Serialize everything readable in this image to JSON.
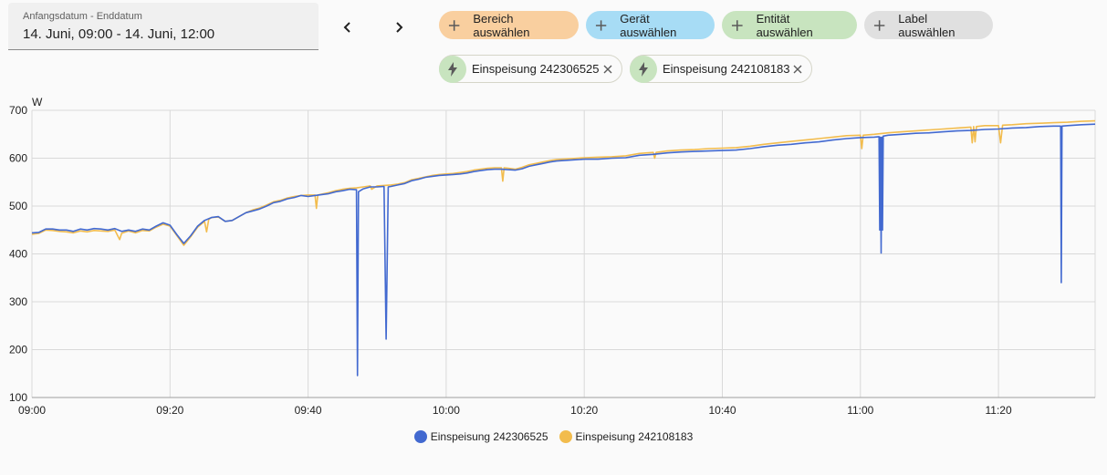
{
  "date_range": {
    "label": "Anfangsdatum - Enddatum",
    "value": "14. Juni, 09:00 - 14. Juni, 12:00"
  },
  "nav": {
    "prev_icon": "chevron-left-icon",
    "next_icon": "chevron-right-icon"
  },
  "target_chips": {
    "area": "Bereich auswählen",
    "device": "Gerät auswählen",
    "entity": "Entität auswählen",
    "label": "Label auswählen"
  },
  "selected_entities": [
    {
      "name": "Einspeisung 242306525",
      "icon": "lightning-bolt-icon"
    },
    {
      "name": "Einspeisung 242108183",
      "icon": "lightning-bolt-icon"
    }
  ],
  "colors": {
    "chip_area": "#f9cf9f",
    "chip_device": "#a7dcf5",
    "chip_entity": "#c8e4bf",
    "chip_label": "#e0e0e0",
    "series1": "#4269d0",
    "series2": "#f2bc4d"
  },
  "chart_data": {
    "type": "line",
    "ylabel": "W",
    "ylim": [
      100,
      700
    ],
    "yticks": [
      100,
      200,
      300,
      400,
      500,
      600,
      700
    ],
    "xlim_minutes": [
      0,
      154
    ],
    "xticks": [
      {
        "label": "09:00",
        "t": 0
      },
      {
        "label": "09:20",
        "t": 20
      },
      {
        "label": "09:40",
        "t": 40
      },
      {
        "label": "10:00",
        "t": 60
      },
      {
        "label": "10:20",
        "t": 80
      },
      {
        "label": "10:40",
        "t": 100
      },
      {
        "label": "11:00",
        "t": 120
      },
      {
        "label": "11:20",
        "t": 140
      }
    ],
    "grid": true,
    "legend_position": "bottom",
    "series": [
      {
        "name": "Einspeisung 242306525",
        "color": "#4269d0",
        "points": [
          [
            0,
            444
          ],
          [
            1,
            445
          ],
          [
            2,
            452
          ],
          [
            3,
            452
          ],
          [
            4,
            450
          ],
          [
            5,
            450
          ],
          [
            6,
            447
          ],
          [
            7,
            452
          ],
          [
            8,
            450
          ],
          [
            9,
            453
          ],
          [
            10,
            452
          ],
          [
            11,
            450
          ],
          [
            12,
            453
          ],
          [
            13,
            447
          ],
          [
            14,
            450
          ],
          [
            15,
            447
          ],
          [
            16,
            452
          ],
          [
            17,
            450
          ],
          [
            18,
            458
          ],
          [
            19,
            465
          ],
          [
            20,
            460
          ],
          [
            21,
            440
          ],
          [
            22,
            422
          ],
          [
            23,
            438
          ],
          [
            24,
            458
          ],
          [
            25,
            470
          ],
          [
            26,
            476
          ],
          [
            27,
            478
          ],
          [
            28,
            468
          ],
          [
            29,
            470
          ],
          [
            30,
            478
          ],
          [
            31,
            486
          ],
          [
            32,
            490
          ],
          [
            33,
            494
          ],
          [
            34,
            500
          ],
          [
            35,
            507
          ],
          [
            36,
            510
          ],
          [
            37,
            515
          ],
          [
            38,
            518
          ],
          [
            39,
            522
          ],
          [
            40,
            520
          ],
          [
            41,
            522
          ],
          [
            42,
            524
          ],
          [
            43,
            526
          ],
          [
            44,
            530
          ],
          [
            45,
            532
          ],
          [
            46,
            535
          ],
          [
            47,
            534
          ],
          [
            47.15,
            146
          ],
          [
            47.3,
            530
          ],
          [
            48,
            536
          ],
          [
            49,
            540
          ],
          [
            50,
            540
          ],
          [
            51,
            541
          ],
          [
            51.3,
            222
          ],
          [
            51.6,
            540
          ],
          [
            52,
            541
          ],
          [
            53,
            544
          ],
          [
            54,
            547
          ],
          [
            55,
            553
          ],
          [
            56,
            556
          ],
          [
            57,
            560
          ],
          [
            58,
            562
          ],
          [
            59,
            564
          ],
          [
            60,
            565
          ],
          [
            61,
            566
          ],
          [
            62,
            567
          ],
          [
            63,
            569
          ],
          [
            64,
            572
          ],
          [
            65,
            574
          ],
          [
            66,
            576
          ],
          [
            67,
            577
          ],
          [
            68,
            577
          ],
          [
            69,
            576
          ],
          [
            70,
            575
          ],
          [
            71,
            578
          ],
          [
            72,
            583
          ],
          [
            73,
            586
          ],
          [
            74,
            589
          ],
          [
            75,
            592
          ],
          [
            76,
            594
          ],
          [
            77,
            595
          ],
          [
            78,
            596
          ],
          [
            79,
            597
          ],
          [
            80,
            598
          ],
          [
            82,
            598
          ],
          [
            84,
            600
          ],
          [
            86,
            601
          ],
          [
            88,
            606
          ],
          [
            90,
            608
          ],
          [
            92,
            611
          ],
          [
            94,
            613
          ],
          [
            96,
            614
          ],
          [
            98,
            615
          ],
          [
            100,
            616
          ],
          [
            102,
            617
          ],
          [
            104,
            620
          ],
          [
            106,
            624
          ],
          [
            108,
            627
          ],
          [
            110,
            629
          ],
          [
            112,
            632
          ],
          [
            114,
            634
          ],
          [
            116,
            638
          ],
          [
            118,
            641
          ],
          [
            120,
            643
          ],
          [
            122,
            644
          ],
          [
            122.7,
            645
          ],
          [
            122.8,
            450
          ],
          [
            122.9,
            644
          ],
          [
            123,
            402
          ],
          [
            123.1,
            644
          ],
          [
            123.2,
            450
          ],
          [
            123.3,
            646
          ],
          [
            124,
            648
          ],
          [
            126,
            650
          ],
          [
            128,
            652
          ],
          [
            130,
            653
          ],
          [
            132,
            655
          ],
          [
            134,
            657
          ],
          [
            136,
            658
          ],
          [
            138,
            660
          ],
          [
            140,
            661
          ],
          [
            142,
            663
          ],
          [
            144,
            664
          ],
          [
            146,
            666
          ],
          [
            148,
            667
          ],
          [
            149,
            667
          ],
          [
            149.1,
            340
          ],
          [
            149.2,
            667
          ],
          [
            150,
            668
          ],
          [
            152,
            670
          ],
          [
            154,
            671
          ]
        ]
      },
      {
        "name": "Einspeisung 242108183",
        "color": "#f2bc4d",
        "points": [
          [
            0,
            441
          ],
          [
            1,
            443
          ],
          [
            2,
            450
          ],
          [
            3,
            449
          ],
          [
            4,
            447
          ],
          [
            5,
            446
          ],
          [
            6,
            444
          ],
          [
            7,
            448
          ],
          [
            8,
            446
          ],
          [
            9,
            449
          ],
          [
            10,
            448
          ],
          [
            11,
            447
          ],
          [
            12,
            450
          ],
          [
            12.7,
            430
          ],
          [
            13,
            443
          ],
          [
            14,
            448
          ],
          [
            15,
            444
          ],
          [
            16,
            449
          ],
          [
            17,
            448
          ],
          [
            18,
            456
          ],
          [
            19,
            462
          ],
          [
            20,
            458
          ],
          [
            21,
            438
          ],
          [
            22,
            418
          ],
          [
            23,
            436
          ],
          [
            24,
            456
          ],
          [
            25,
            468
          ],
          [
            25.3,
            446
          ],
          [
            25.6,
            472
          ],
          [
            26,
            476
          ],
          [
            27,
            477
          ],
          [
            28,
            468
          ],
          [
            29,
            470
          ],
          [
            30,
            478
          ],
          [
            31,
            486
          ],
          [
            32,
            492
          ],
          [
            33,
            496
          ],
          [
            34,
            502
          ],
          [
            35,
            509
          ],
          [
            36,
            512
          ],
          [
            37,
            517
          ],
          [
            38,
            520
          ],
          [
            39,
            522
          ],
          [
            40,
            523
          ],
          [
            41,
            523
          ],
          [
            41.2,
            495
          ],
          [
            41.4,
            523
          ],
          [
            42,
            525
          ],
          [
            43,
            528
          ],
          [
            44,
            532
          ],
          [
            45,
            535
          ],
          [
            46,
            537
          ],
          [
            47,
            538
          ],
          [
            48,
            540
          ],
          [
            49,
            542
          ],
          [
            49.2,
            535
          ],
          [
            50,
            542
          ],
          [
            51,
            543
          ],
          [
            52,
            544
          ],
          [
            53,
            546
          ],
          [
            54,
            549
          ],
          [
            55,
            555
          ],
          [
            56,
            558
          ],
          [
            57,
            561
          ],
          [
            58,
            564
          ],
          [
            59,
            566
          ],
          [
            60,
            567
          ],
          [
            61,
            568
          ],
          [
            62,
            570
          ],
          [
            63,
            572
          ],
          [
            64,
            575
          ],
          [
            65,
            577
          ],
          [
            66,
            579
          ],
          [
            67,
            580
          ],
          [
            68,
            580
          ],
          [
            68.2,
            552
          ],
          [
            68.4,
            580
          ],
          [
            69,
            579
          ],
          [
            70,
            577
          ],
          [
            71,
            581
          ],
          [
            72,
            586
          ],
          [
            73,
            589
          ],
          [
            74,
            592
          ],
          [
            75,
            595
          ],
          [
            76,
            597
          ],
          [
            77,
            598
          ],
          [
            78,
            599
          ],
          [
            79,
            600
          ],
          [
            80,
            601
          ],
          [
            82,
            602
          ],
          [
            84,
            603
          ],
          [
            86,
            605
          ],
          [
            88,
            610
          ],
          [
            90,
            612
          ],
          [
            90.2,
            600
          ],
          [
            90.4,
            612
          ],
          [
            92,
            615
          ],
          [
            94,
            617
          ],
          [
            96,
            618
          ],
          [
            98,
            620
          ],
          [
            100,
            621
          ],
          [
            102,
            622
          ],
          [
            104,
            625
          ],
          [
            106,
            629
          ],
          [
            108,
            632
          ],
          [
            110,
            635
          ],
          [
            112,
            638
          ],
          [
            114,
            641
          ],
          [
            116,
            644
          ],
          [
            118,
            647
          ],
          [
            120,
            648
          ],
          [
            120.2,
            620
          ],
          [
            120.4,
            648
          ],
          [
            122,
            650
          ],
          [
            124,
            653
          ],
          [
            126,
            655
          ],
          [
            128,
            657
          ],
          [
            130,
            659
          ],
          [
            132,
            661
          ],
          [
            134,
            663
          ],
          [
            136,
            665
          ],
          [
            136.2,
            632
          ],
          [
            136.4,
            666
          ],
          [
            136.6,
            634
          ],
          [
            136.8,
            666
          ],
          [
            138,
            668
          ],
          [
            140,
            668
          ],
          [
            140.3,
            632
          ],
          [
            140.6,
            669
          ],
          [
            142,
            670
          ],
          [
            144,
            672
          ],
          [
            146,
            673
          ],
          [
            148,
            674
          ],
          [
            150,
            675
          ],
          [
            152,
            677
          ],
          [
            154,
            678
          ]
        ]
      }
    ]
  }
}
